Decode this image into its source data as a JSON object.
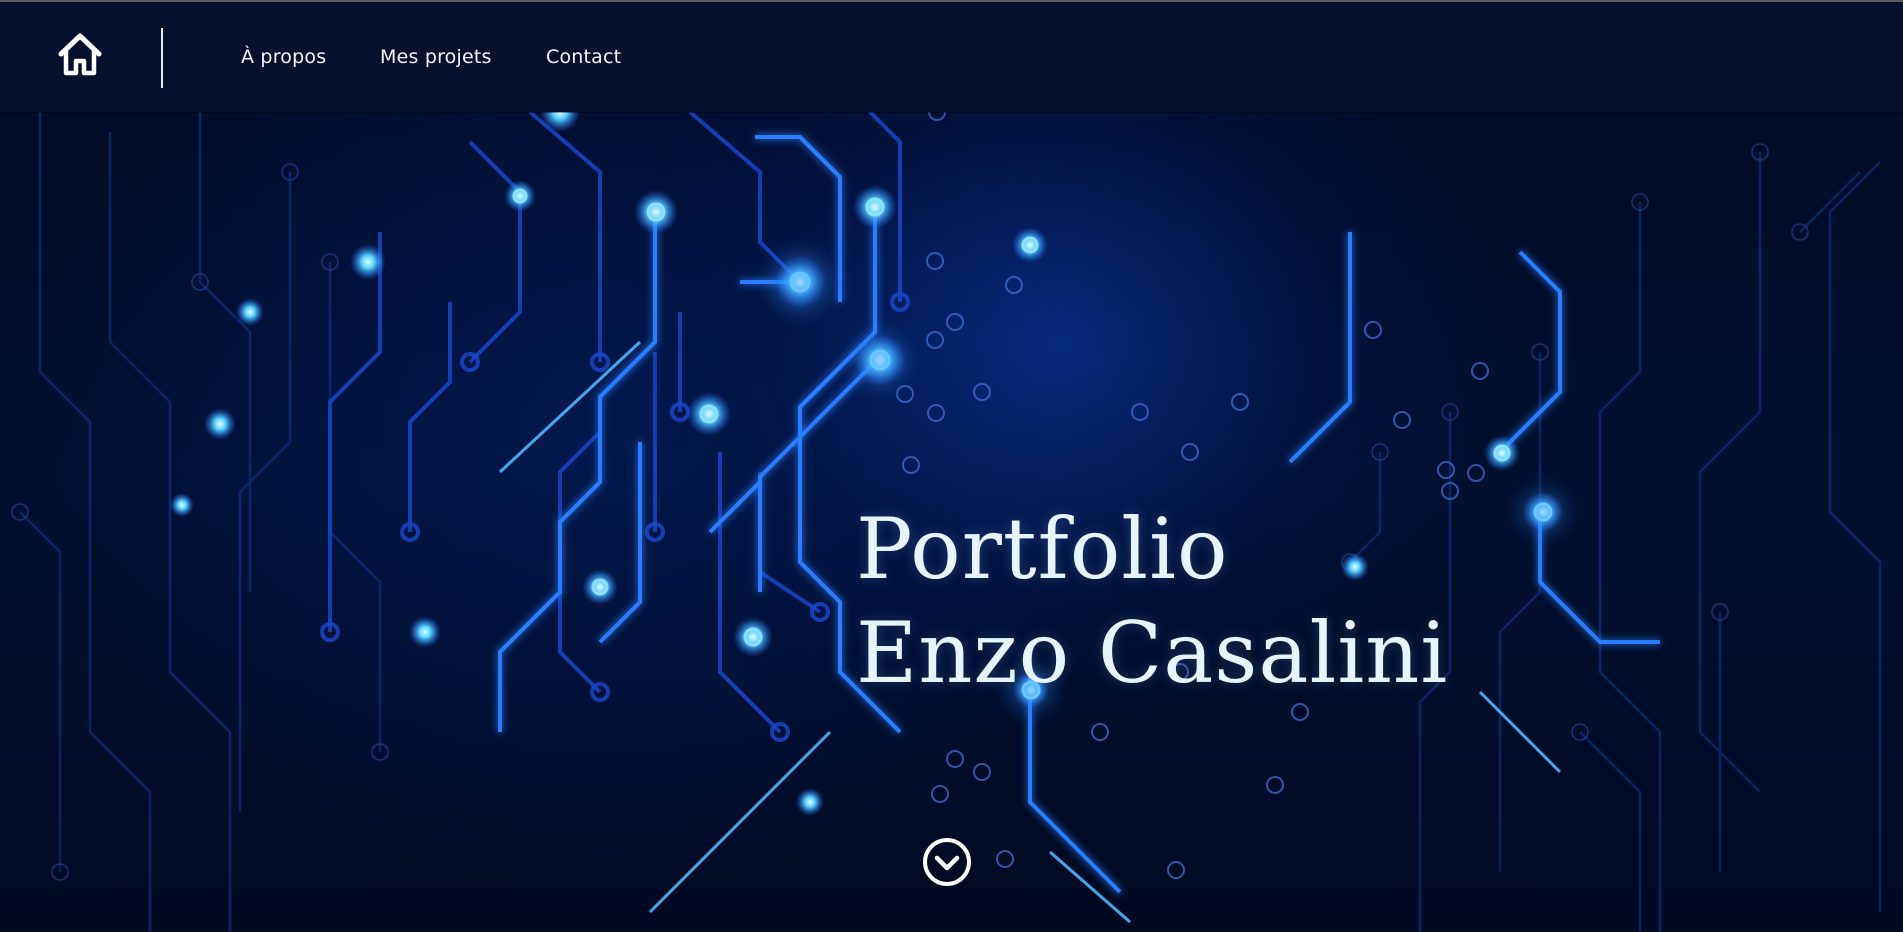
{
  "nav": {
    "home_icon": "home-icon",
    "items": [
      {
        "label": "À propos"
      },
      {
        "label": "Mes projets"
      },
      {
        "label": "Contact"
      }
    ]
  },
  "hero": {
    "title_line1": "Portfolio",
    "title_line2": "Enzo Casalini",
    "scroll_icon": "chevron-down-circle-icon",
    "background": "circuit-board-image"
  },
  "colors": {
    "navbar_bg": "#07112e",
    "text": "#f2f5fb",
    "circuit_glow": "#1e6bff",
    "circuit_bright": "#5cc8ff"
  }
}
